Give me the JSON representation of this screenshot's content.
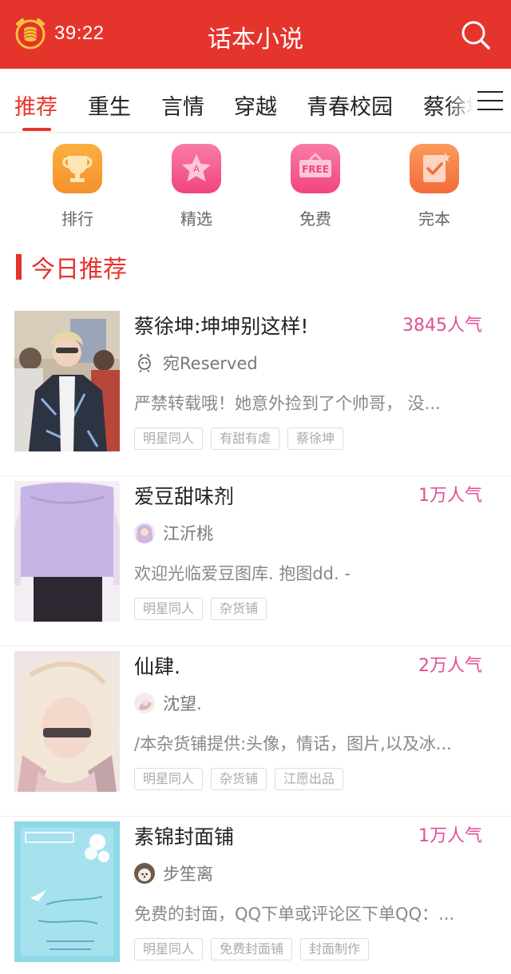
{
  "header": {
    "timer": "39:22",
    "title": "话本小说",
    "clock_icon": "coin-alarm-clock-icon",
    "search_icon": "search-icon"
  },
  "tabs": [
    "推荐",
    "重生",
    "言情",
    "穿越",
    "青春校园",
    "蔡徐坤"
  ],
  "active_tab": "推荐",
  "menu_icon": "menu-icon",
  "categories": [
    {
      "label": "排行",
      "icon": "trophy-icon",
      "color": "#f5912c"
    },
    {
      "label": "精选",
      "icon": "star-icon",
      "color": "#f0457f"
    },
    {
      "label": "免费",
      "icon": "free-sign-icon",
      "color": "#f0457f"
    },
    {
      "label": "完本",
      "icon": "checkmark-note-icon",
      "color": "#f36b3a"
    }
  ],
  "section": {
    "title": "今日推荐"
  },
  "books": [
    {
      "title": "蔡徐坤:坤坤别这样!",
      "popularity": "3845人气",
      "author": "宛Reserved",
      "description": "严禁转载哦！她意外捡到了个帅哥， 没...",
      "tags": [
        "明星同人",
        "有甜有虐",
        "蔡徐坤"
      ]
    },
    {
      "title": "爱豆甜味剂",
      "popularity": "1万人气",
      "author": "江沂桃",
      "description": "欢迎光临爱豆图库. 抱图dd. -",
      "tags": [
        "明星同人",
        "杂货铺"
      ]
    },
    {
      "title": "仙肆.",
      "popularity": "2万人气",
      "author": "沈望.",
      "description": "/本杂货铺提供:头像，情话，图片,以及冰...",
      "tags": [
        "明星同人",
        "杂货铺",
        "江愿出品"
      ]
    },
    {
      "title": "素锦封面铺",
      "popularity": "1万人气",
      "author": "步笙离",
      "description": "免费的封面，QQ下单或评论区下单QQ：...",
      "tags": [
        "明星同人",
        "免费封面铺",
        "封面制作"
      ]
    }
  ],
  "colors": {
    "brand": "#e5342c",
    "popularity": "#e14e98"
  }
}
